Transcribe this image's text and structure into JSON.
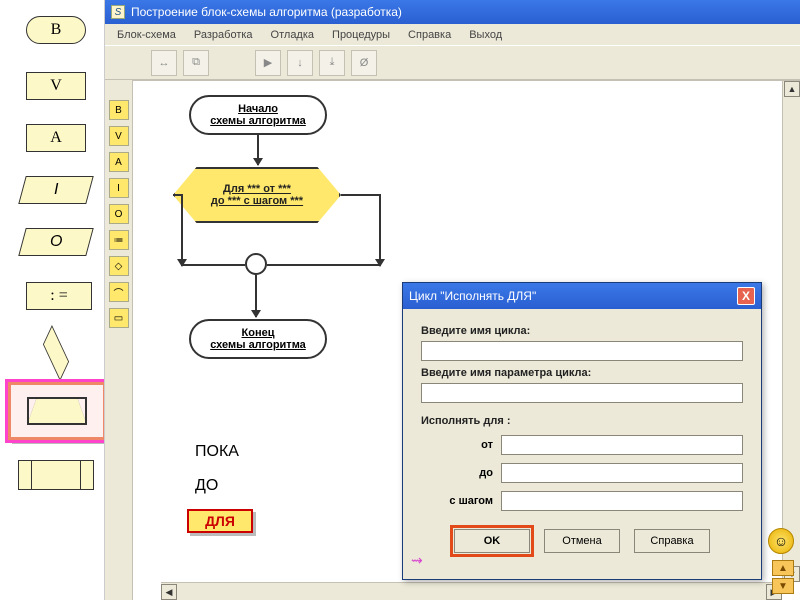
{
  "app": {
    "title": "Построение блок-схемы алгоритма (разработка)",
    "icon_letter": "S"
  },
  "menu": {
    "items": [
      "Блок-схема",
      "Разработка",
      "Отладка",
      "Процедуры",
      "Справка",
      "Выход"
    ]
  },
  "toolbar": {
    "btn1": "↔",
    "btn2": "⧉",
    "btn3": "▶",
    "btn4": "↓",
    "btn5": "⤓",
    "btn6": "Ø"
  },
  "vtoolbar": {
    "items": [
      "B",
      "V",
      "A",
      "I",
      "О",
      "≔",
      "◇",
      "⌒",
      "▭"
    ]
  },
  "palette": {
    "b": "B",
    "v": "V",
    "a": "A",
    "i": "I",
    "o": "O",
    "assign": ": ="
  },
  "flowchart": {
    "start_l1": "Начало",
    "start_l2": "схемы алгоритма",
    "loop_l1": "Для *** от ***",
    "loop_l2": "до *** с шагом ***",
    "end_l1": "Конец",
    "end_l2": "схемы алгоритма"
  },
  "labels": {
    "poka": "ПОКА",
    "do": "ДО",
    "dlya": "ДЛЯ"
  },
  "dialog": {
    "title": "Цикл \"Исполнять ДЛЯ\"",
    "lab_name": "Введите имя цикла:",
    "lab_param": "Введите имя параметра цикла:",
    "lab_execute": "Исполнять для   :",
    "row_ot": "от",
    "row_do": "до",
    "row_step": "с шагом",
    "ok": "OK",
    "cancel": "Отмена",
    "help": "Справка",
    "close": "X",
    "arrow": "⇝"
  },
  "nav": {
    "up": "▲",
    "down": "▼"
  },
  "smiley": "☺"
}
